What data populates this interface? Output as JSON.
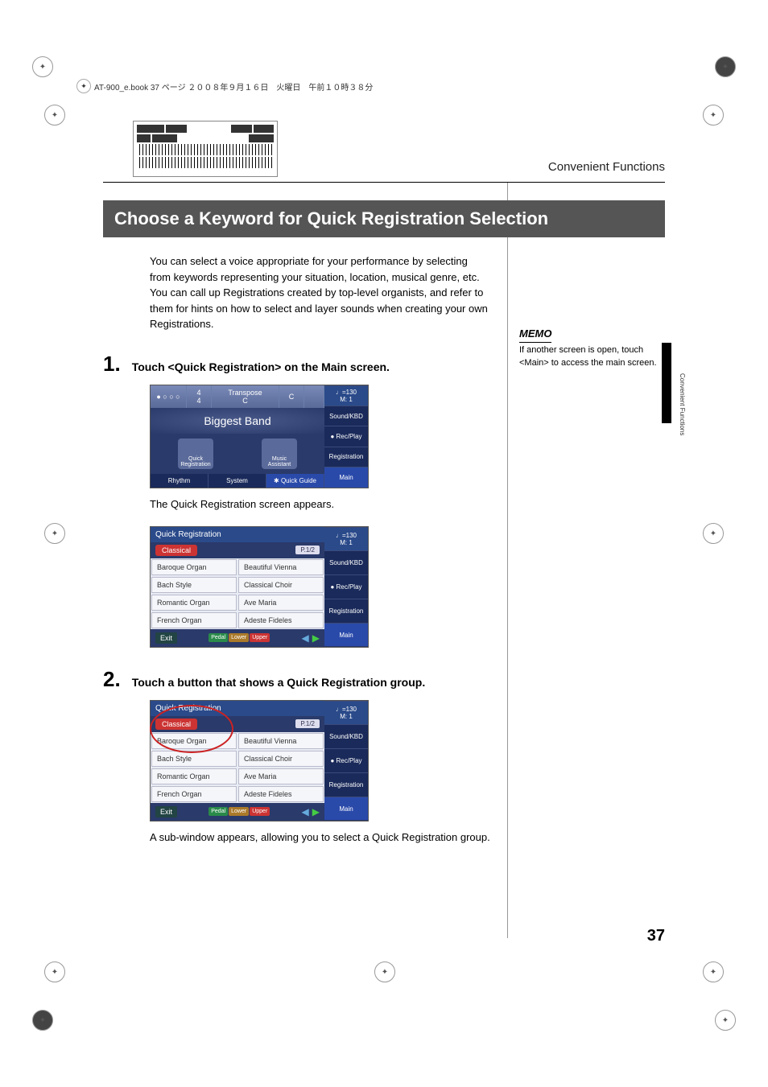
{
  "header_line": "AT-900_e.book  37 ページ  ２００８年９月１６日　火曜日　午前１０時３８分",
  "section_header": "Convenient Functions",
  "side_text": "Convenient Functions",
  "title": "Choose a Keyword for Quick Registration Selection",
  "intro": "You can select a voice appropriate for your performance by selecting from keywords representing your situation, location, musical genre, etc. You can call up Registrations created by top-level organists, and refer to them for hints on how to select and layer sounds when creating your own Registrations.",
  "memo": {
    "label": "MEMO",
    "text": "If another screen is open, touch <Main> to access the main screen."
  },
  "steps": {
    "s1": {
      "num": "1.",
      "text": "Touch <Quick Registration> on the Main screen."
    },
    "s1_caption": "The Quick Registration screen appears.",
    "s2": {
      "num": "2.",
      "text": "Touch a button that shows a Quick Registration group."
    },
    "s2_caption": "A sub-window appears, allowing you to select a Quick Registration group."
  },
  "main_screen": {
    "timesig": "4\n4",
    "transpose_label": "Transpose",
    "transpose_val": "C",
    "key": "C",
    "tempo": "♩=130",
    "measure": "M:    1",
    "voice_name": "Biggest Band",
    "icons": {
      "qr": "Quick Registration",
      "ma": "Music Assistant"
    },
    "tabs": {
      "rhythm": "Rhythm",
      "system": "System",
      "quickguide": "✱ Quick Guide"
    },
    "side": {
      "soundkbd": "Sound/KBD",
      "recplay": "● Rec/Play",
      "registration": "Registration",
      "main": "Main"
    }
  },
  "qr_screen": {
    "header": "Quick Registration",
    "category": "Classical",
    "page": "P.1/2",
    "tempo": "♩=130",
    "measure": "M:    1",
    "rows": [
      [
        "Baroque Organ",
        "Beautiful Vienna"
      ],
      [
        "Bach Style",
        "Classical Choir"
      ],
      [
        "Romantic Organ",
        "Ave Maria"
      ],
      [
        "French Organ",
        "Adeste Fideles"
      ]
    ],
    "exit": "Exit",
    "parts": {
      "pedal": "Pedal",
      "lower": "Lower",
      "upper": "Upper"
    },
    "side": {
      "soundkbd": "Sound/KBD",
      "recplay": "● Rec/Play",
      "registration": "Registration",
      "main": "Main"
    }
  },
  "page_number": "37"
}
